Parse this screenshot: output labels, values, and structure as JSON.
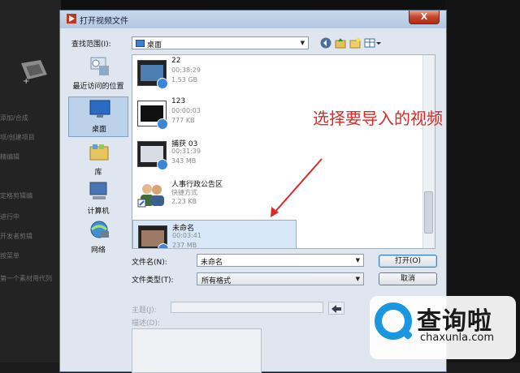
{
  "background": {
    "left_items": [
      "添加/合成",
      "项/创建项目",
      "精编辑",
      "定格剪辑编",
      "进行中",
      "开发者剪辑",
      "按菜单",
      "第一个素材用代列"
    ]
  },
  "dialog": {
    "title": "打开视频文件",
    "close_label": "X",
    "lookin_label": "查找范围(I):",
    "lookin_value": "桌面",
    "places": [
      {
        "label": "最近访问的位置",
        "icon": "recent-places-icon"
      },
      {
        "label": "桌面",
        "icon": "desktop-icon"
      },
      {
        "label": "库",
        "icon": "library-icon"
      },
      {
        "label": "计算机",
        "icon": "computer-icon"
      },
      {
        "label": "网络",
        "icon": "network-icon"
      }
    ],
    "files": [
      {
        "name": "22",
        "line2": "00:38:29",
        "line3": "1.53 GB",
        "icon": "video-thumbnail-icon"
      },
      {
        "name": "123",
        "line2": "00:00:03",
        "line3": "777 KB",
        "icon": "video-thumbnail-icon"
      },
      {
        "name": "捕获 03",
        "line2": "00:31:39",
        "line3": "343 MB",
        "icon": "video-thumbnail-icon"
      },
      {
        "name": "人事行政公告区",
        "line2": "快捷方式",
        "line3": "2.23 KB",
        "icon": "shortcut-people-icon"
      },
      {
        "name": "未命名",
        "line2": "00:03:41",
        "line3": "237 MB",
        "icon": "video-thumbnail-icon"
      }
    ],
    "filename_label": "文件名(N):",
    "filename_value": "未命名",
    "filetype_label": "文件类型(T):",
    "filetype_value": "所有格式",
    "open_button": "打开(O)",
    "cancel_button": "取消",
    "subject_label": "主题(J):",
    "description_label": "描述(D):"
  },
  "annotation": "选择要导入的视频",
  "watermark": {
    "cn": "查询啦",
    "en": "chaxunla.com"
  },
  "colors": {
    "annotation": "#d62b26",
    "watermark_blue": "#1b96e0",
    "selection": "#d8e7f7"
  }
}
